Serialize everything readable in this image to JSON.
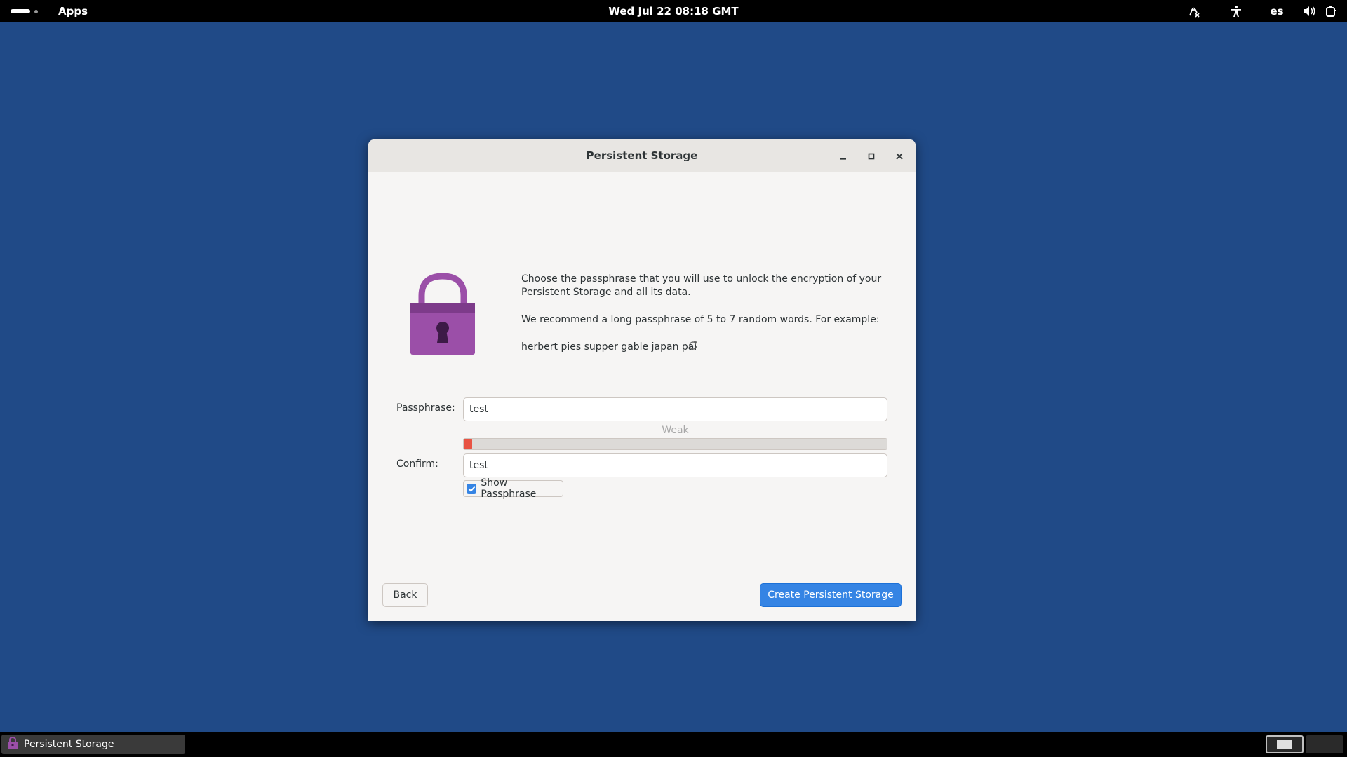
{
  "topbar": {
    "activities_icon": "activities-pill",
    "apps_label": "Apps",
    "clock": "Wed Jul 22  08:18 GMT",
    "tray": {
      "icons": [
        "cleaner-icon",
        "accessibility-icon",
        "volume-icon",
        "power-icon"
      ],
      "language": "es"
    }
  },
  "dialog": {
    "title": "Persistent Storage",
    "window_buttons": [
      "minimize-icon",
      "maximize-icon",
      "close-icon"
    ],
    "intro": "Choose the passphrase that you will use to unlock the encryption of your",
    "intro_line2": "Persistent Storage and all its data.",
    "recommend": "We recommend a long passphrase of 5 to 7 random words. For example:",
    "example_passphrase": "herbert pies supper gable japan pal",
    "passphrase_label": "Passphrase:",
    "passphrase_value": "test",
    "strength_label": "Weak",
    "strength_fraction": 0.02,
    "confirm_label": "Confirm:",
    "confirm_value": "test",
    "show_passphrase_label": "Show Passphrase",
    "show_passphrase_checked": true,
    "back_label": "Back",
    "create_label": "Create Persistent Storage"
  },
  "taskbar": {
    "task_label": "Persistent Storage",
    "workspaces": 2,
    "active_workspace": 1
  },
  "colors": {
    "desktop": "#204a87",
    "accent": "#3584e4",
    "lock": "#9b4fa8",
    "weak": "#e85343"
  }
}
